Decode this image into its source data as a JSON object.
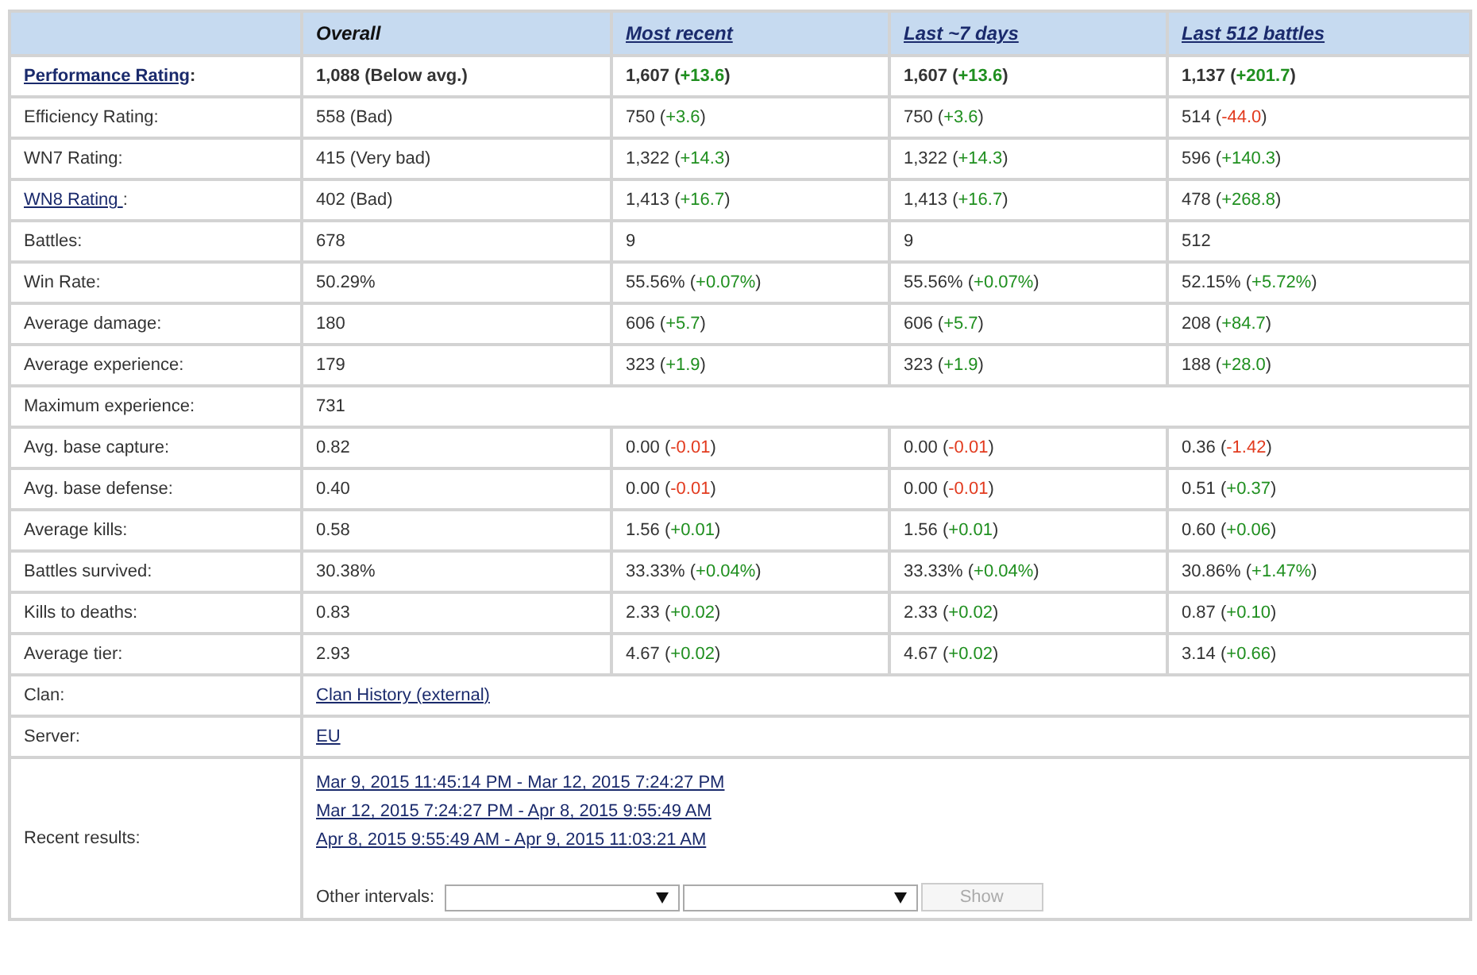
{
  "columns": [
    {
      "label": "Overall",
      "link": false
    },
    {
      "label": "Most recent",
      "link": true
    },
    {
      "label": "Last ~7 days",
      "link": true
    },
    {
      "label": "Last 512 battles",
      "link": true
    }
  ],
  "rows": [
    {
      "kind": "stats",
      "bold": true,
      "label": {
        "text": "Performance Rating",
        "link": true,
        "after": ":"
      },
      "cells": [
        {
          "text": "1,088 (Below avg.)"
        },
        {
          "text": "1,607 (",
          "change": "+13.6",
          "end": ")",
          "gain": true
        },
        {
          "text": "1,607 (",
          "change": "+13.6",
          "end": ")",
          "gain": true
        },
        {
          "text": "1,137 (",
          "change": "+201.7",
          "end": ")",
          "gain": true
        }
      ]
    },
    {
      "kind": "stats",
      "bold": false,
      "label": {
        "text": "Efficiency Rating:",
        "link": false
      },
      "cells": [
        {
          "text": "558 (Bad)"
        },
        {
          "text": "750 (",
          "change": "+3.6",
          "end": ")",
          "gain": true
        },
        {
          "text": "750 (",
          "change": "+3.6",
          "end": ")",
          "gain": true
        },
        {
          "text": "514 (",
          "change": "-44.0",
          "end": ")",
          "gain": false
        }
      ]
    },
    {
      "kind": "stats",
      "bold": false,
      "label": {
        "text": "WN7 Rating:",
        "link": false
      },
      "cells": [
        {
          "text": "415 (Very bad)"
        },
        {
          "text": "1,322 (",
          "change": "+14.3",
          "end": ")",
          "gain": true
        },
        {
          "text": "1,322 (",
          "change": "+14.3",
          "end": ")",
          "gain": true
        },
        {
          "text": "596 (",
          "change": "+140.3",
          "end": ")",
          "gain": true
        }
      ]
    },
    {
      "kind": "stats",
      "bold": false,
      "label": {
        "text": "WN8 Rating ",
        "link": true,
        "after": ":"
      },
      "cells": [
        {
          "text": "402 (Bad)"
        },
        {
          "text": "1,413 (",
          "change": "+16.7",
          "end": ")",
          "gain": true
        },
        {
          "text": "1,413 (",
          "change": "+16.7",
          "end": ")",
          "gain": true
        },
        {
          "text": "478 (",
          "change": "+268.8",
          "end": ")",
          "gain": true
        }
      ]
    },
    {
      "kind": "stats",
      "bold": false,
      "label": {
        "text": "Battles:",
        "link": false
      },
      "cells": [
        {
          "text": "678"
        },
        {
          "text": "9"
        },
        {
          "text": "9"
        },
        {
          "text": "512"
        }
      ]
    },
    {
      "kind": "stats",
      "bold": false,
      "label": {
        "text": "Win Rate:",
        "link": false
      },
      "cells": [
        {
          "text": "50.29%"
        },
        {
          "text": "55.56% (",
          "change": "+0.07%",
          "end": ")",
          "gain": true
        },
        {
          "text": "55.56% (",
          "change": "+0.07%",
          "end": ")",
          "gain": true
        },
        {
          "text": "52.15% (",
          "change": "+5.72%",
          "end": ")",
          "gain": true
        }
      ]
    },
    {
      "kind": "stats",
      "bold": false,
      "label": {
        "text": "Average damage:",
        "link": false
      },
      "cells": [
        {
          "text": "180"
        },
        {
          "text": "606 (",
          "change": "+5.7",
          "end": ")",
          "gain": true
        },
        {
          "text": "606 (",
          "change": "+5.7",
          "end": ")",
          "gain": true
        },
        {
          "text": "208 (",
          "change": "+84.7",
          "end": ")",
          "gain": true
        }
      ]
    },
    {
      "kind": "stats",
      "bold": false,
      "label": {
        "text": "Average experience:",
        "link": false
      },
      "cells": [
        {
          "text": "179"
        },
        {
          "text": "323 (",
          "change": "+1.9",
          "end": ")",
          "gain": true
        },
        {
          "text": "323 (",
          "change": "+1.9",
          "end": ")",
          "gain": true
        },
        {
          "text": "188 (",
          "change": "+28.0",
          "end": ")",
          "gain": true
        }
      ]
    },
    {
      "kind": "wide",
      "label": {
        "text": "Maximum experience:",
        "link": false
      },
      "value": "731"
    },
    {
      "kind": "stats",
      "bold": false,
      "label": {
        "text": "Avg. base capture:",
        "link": false
      },
      "cells": [
        {
          "text": "0.82"
        },
        {
          "text": "0.00 (",
          "change": "-0.01",
          "end": ")",
          "gain": false
        },
        {
          "text": "0.00 (",
          "change": "-0.01",
          "end": ")",
          "gain": false
        },
        {
          "text": "0.36 (",
          "change": "-1.42",
          "end": ")",
          "gain": false
        }
      ]
    },
    {
      "kind": "stats",
      "bold": false,
      "label": {
        "text": "Avg. base defense:",
        "link": false
      },
      "cells": [
        {
          "text": "0.40"
        },
        {
          "text": "0.00 (",
          "change": "-0.01",
          "end": ")",
          "gain": false
        },
        {
          "text": "0.00 (",
          "change": "-0.01",
          "end": ")",
          "gain": false
        },
        {
          "text": "0.51 (",
          "change": "+0.37",
          "end": ")",
          "gain": true
        }
      ]
    },
    {
      "kind": "stats",
      "bold": false,
      "label": {
        "text": "Average kills:",
        "link": false
      },
      "cells": [
        {
          "text": "0.58"
        },
        {
          "text": "1.56 (",
          "change": "+0.01",
          "end": ")",
          "gain": true
        },
        {
          "text": "1.56 (",
          "change": "+0.01",
          "end": ")",
          "gain": true
        },
        {
          "text": "0.60 (",
          "change": "+0.06",
          "end": ")",
          "gain": true
        }
      ]
    },
    {
      "kind": "stats",
      "bold": false,
      "label": {
        "text": "Battles survived:",
        "link": false
      },
      "cells": [
        {
          "text": "30.38%"
        },
        {
          "text": "33.33% (",
          "change": "+0.04%",
          "end": ")",
          "gain": true
        },
        {
          "text": "33.33% (",
          "change": "+0.04%",
          "end": ")",
          "gain": true
        },
        {
          "text": "30.86% (",
          "change": "+1.47%",
          "end": ")",
          "gain": true
        }
      ]
    },
    {
      "kind": "stats",
      "bold": false,
      "label": {
        "text": "Kills to deaths:",
        "link": false
      },
      "cells": [
        {
          "text": "0.83"
        },
        {
          "text": "2.33 (",
          "change": "+0.02",
          "end": ")",
          "gain": true
        },
        {
          "text": "2.33 (",
          "change": "+0.02",
          "end": ")",
          "gain": true
        },
        {
          "text": "0.87 (",
          "change": "+0.10",
          "end": ")",
          "gain": true
        }
      ]
    },
    {
      "kind": "stats",
      "bold": false,
      "label": {
        "text": "Average tier:",
        "link": false
      },
      "cells": [
        {
          "text": "2.93"
        },
        {
          "text": "4.67 (",
          "change": "+0.02",
          "end": ")",
          "gain": true
        },
        {
          "text": "4.67 (",
          "change": "+0.02",
          "end": ")",
          "gain": true
        },
        {
          "text": "3.14 (",
          "change": "+0.66",
          "end": ")",
          "gain": true
        }
      ]
    },
    {
      "kind": "link",
      "label": {
        "text": "Clan:",
        "link": false
      },
      "value": "Clan History (external)"
    },
    {
      "kind": "link",
      "label": {
        "text": "Server:",
        "link": false
      },
      "value": "EU"
    },
    {
      "kind": "recent",
      "label": {
        "text": "Recent results:",
        "link": false
      },
      "links": [
        "Mar 9, 2015 11:45:14 PM - Mar 12, 2015 7:24:27 PM",
        "Mar 12, 2015 7:24:27 PM - Apr 8, 2015 9:55:49 AM",
        "Apr 8, 2015 9:55:49 AM - Apr 9, 2015 11:03:21 AM"
      ],
      "other_label": "Other intervals:",
      "button": {
        "label": "Show",
        "disabled": true
      }
    }
  ]
}
